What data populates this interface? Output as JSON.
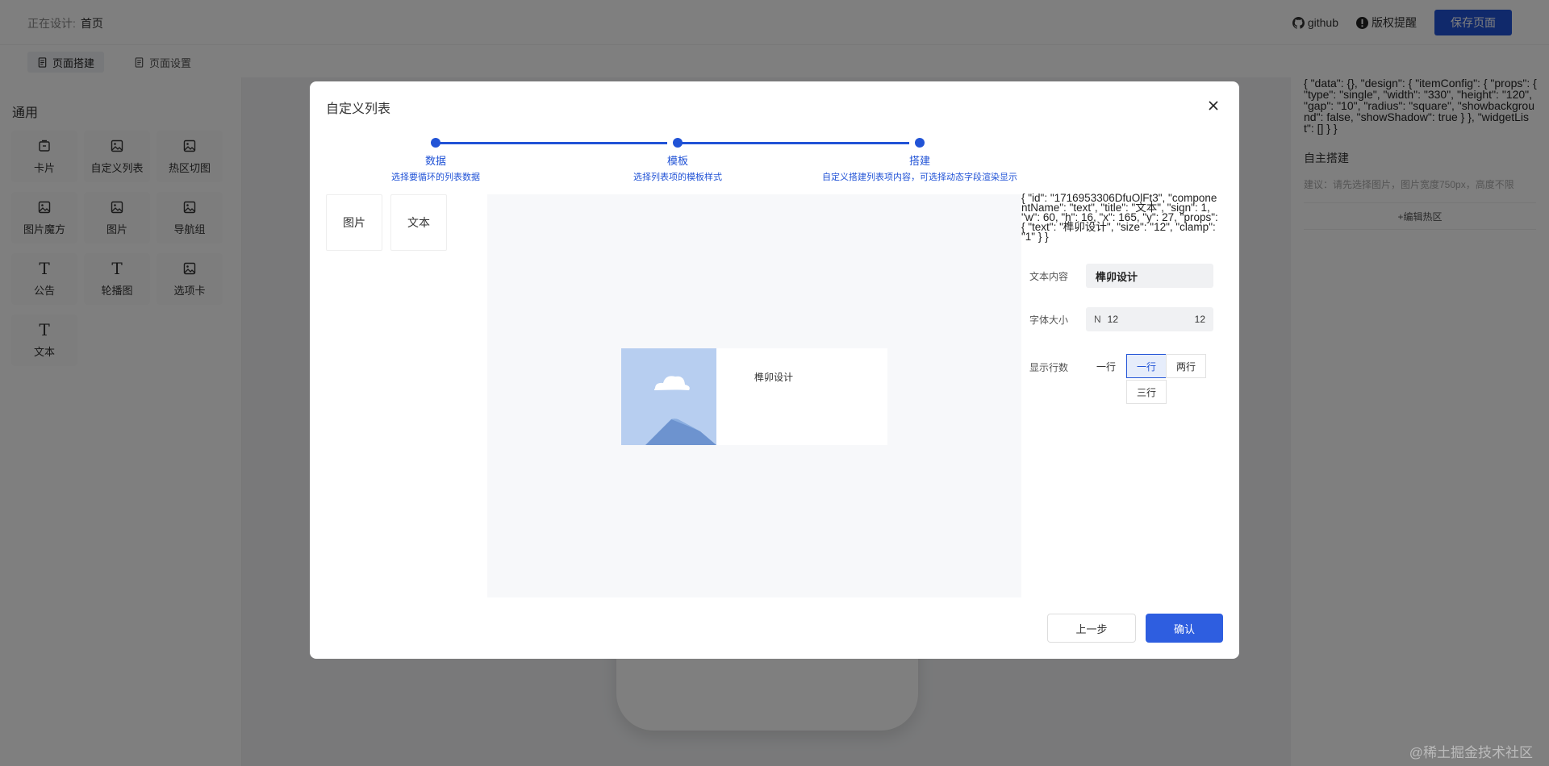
{
  "header": {
    "designing_label": "正在设计:",
    "page_name": "首页",
    "github_label": "github",
    "copyright_label": "版权提醒",
    "save_label": "保存页面"
  },
  "subtabs": [
    {
      "label": "页面搭建",
      "icon": "document-icon",
      "active": true
    },
    {
      "label": "页面设置",
      "icon": "document-icon",
      "active": false
    }
  ],
  "left_panel": {
    "group_title": "通用",
    "components": [
      {
        "label": "卡片",
        "icon": "card-icon"
      },
      {
        "label": "自定义列表",
        "icon": "image-icon"
      },
      {
        "label": "热区切图",
        "icon": "image-icon"
      },
      {
        "label": "图片魔方",
        "icon": "image-icon"
      },
      {
        "label": "图片",
        "icon": "image-icon"
      },
      {
        "label": "导航组",
        "icon": "image-icon"
      },
      {
        "label": "公告",
        "icon": "text-icon"
      },
      {
        "label": "轮播图",
        "icon": "text-icon"
      },
      {
        "label": "选项卡",
        "icon": "image-icon"
      },
      {
        "label": "文本",
        "icon": "text-icon"
      }
    ]
  },
  "right_panel": {
    "json": "{ \"data\": {}, \"design\": { \"itemConfig\": { \"props\": { \"type\": \"single\", \"width\": \"330\", \"height\": \"120\", \"gap\": \"10\", \"radius\": \"square\", \"showbackground\": false, \"showShadow\": true } }, \"widgetList\": [] } }",
    "title": "自主搭建",
    "hint": "建议：请先选择图片，图片宽度750px，高度不限",
    "hot_button": "+编辑热区"
  },
  "watermark": "@稀土掘金技术社区",
  "modal": {
    "title": "自定义列表",
    "steps": [
      {
        "title": "数据",
        "desc": "选择要循环的列表数据"
      },
      {
        "title": "模板",
        "desc": "选择列表项的模板样式"
      },
      {
        "title": "搭建",
        "desc": "自定义搭建列表项内容，可选择动态字段渲染显示"
      }
    ],
    "widgets": [
      "图片",
      "文本"
    ],
    "item_text": "榫卯设计",
    "json": "{ \"id\": \"1716953306DfuOlFt3\", \"componentName\": \"text\", \"title\": \"文本\", \"sign\": 1, \"w\": 60, \"h\": 16, \"x\": 165, \"y\": 27, \"props\": { \"text\": \"榫卯设计\", \"size\": \"12\", \"clamp\": \"1\" } }",
    "form": {
      "text_label": "文本内容",
      "text_value": "榫卯设计",
      "size_label": "字体大小",
      "size_prefix": "N",
      "size_value": "12",
      "size_value_right": "12",
      "clamp_label": "显示行数",
      "clamp_options": [
        "一行",
        "一行",
        "两行",
        "三行"
      ],
      "clamp_selected_index": 1
    },
    "prev_label": "上一步",
    "confirm_label": "确认"
  },
  "colors": {
    "primary": "#2153d6",
    "mask": "rgba(0,0,0,0.5)",
    "image_sky": "#b7cef0",
    "image_mountain": "#6d93cf"
  }
}
